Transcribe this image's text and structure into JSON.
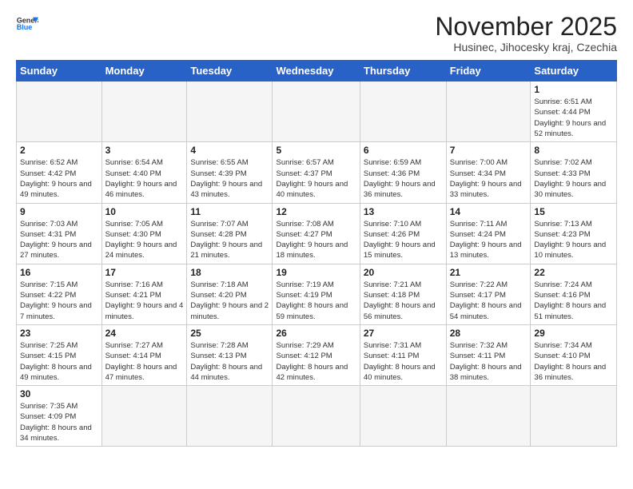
{
  "logo": {
    "line1": "General",
    "line2": "Blue"
  },
  "title": "November 2025",
  "subtitle": "Husinec, Jihocesky kraj, Czechia",
  "weekdays": [
    "Sunday",
    "Monday",
    "Tuesday",
    "Wednesday",
    "Thursday",
    "Friday",
    "Saturday"
  ],
  "weeks": [
    [
      {
        "day": "",
        "info": ""
      },
      {
        "day": "",
        "info": ""
      },
      {
        "day": "",
        "info": ""
      },
      {
        "day": "",
        "info": ""
      },
      {
        "day": "",
        "info": ""
      },
      {
        "day": "",
        "info": ""
      },
      {
        "day": "1",
        "info": "Sunrise: 6:51 AM\nSunset: 4:44 PM\nDaylight: 9 hours\nand 52 minutes."
      }
    ],
    [
      {
        "day": "2",
        "info": "Sunrise: 6:52 AM\nSunset: 4:42 PM\nDaylight: 9 hours\nand 49 minutes."
      },
      {
        "day": "3",
        "info": "Sunrise: 6:54 AM\nSunset: 4:40 PM\nDaylight: 9 hours\nand 46 minutes."
      },
      {
        "day": "4",
        "info": "Sunrise: 6:55 AM\nSunset: 4:39 PM\nDaylight: 9 hours\nand 43 minutes."
      },
      {
        "day": "5",
        "info": "Sunrise: 6:57 AM\nSunset: 4:37 PM\nDaylight: 9 hours\nand 40 minutes."
      },
      {
        "day": "6",
        "info": "Sunrise: 6:59 AM\nSunset: 4:36 PM\nDaylight: 9 hours\nand 36 minutes."
      },
      {
        "day": "7",
        "info": "Sunrise: 7:00 AM\nSunset: 4:34 PM\nDaylight: 9 hours\nand 33 minutes."
      },
      {
        "day": "8",
        "info": "Sunrise: 7:02 AM\nSunset: 4:33 PM\nDaylight: 9 hours\nand 30 minutes."
      }
    ],
    [
      {
        "day": "9",
        "info": "Sunrise: 7:03 AM\nSunset: 4:31 PM\nDaylight: 9 hours\nand 27 minutes."
      },
      {
        "day": "10",
        "info": "Sunrise: 7:05 AM\nSunset: 4:30 PM\nDaylight: 9 hours\nand 24 minutes."
      },
      {
        "day": "11",
        "info": "Sunrise: 7:07 AM\nSunset: 4:28 PM\nDaylight: 9 hours\nand 21 minutes."
      },
      {
        "day": "12",
        "info": "Sunrise: 7:08 AM\nSunset: 4:27 PM\nDaylight: 9 hours\nand 18 minutes."
      },
      {
        "day": "13",
        "info": "Sunrise: 7:10 AM\nSunset: 4:26 PM\nDaylight: 9 hours\nand 15 minutes."
      },
      {
        "day": "14",
        "info": "Sunrise: 7:11 AM\nSunset: 4:24 PM\nDaylight: 9 hours\nand 13 minutes."
      },
      {
        "day": "15",
        "info": "Sunrise: 7:13 AM\nSunset: 4:23 PM\nDaylight: 9 hours\nand 10 minutes."
      }
    ],
    [
      {
        "day": "16",
        "info": "Sunrise: 7:15 AM\nSunset: 4:22 PM\nDaylight: 9 hours\nand 7 minutes."
      },
      {
        "day": "17",
        "info": "Sunrise: 7:16 AM\nSunset: 4:21 PM\nDaylight: 9 hours\nand 4 minutes."
      },
      {
        "day": "18",
        "info": "Sunrise: 7:18 AM\nSunset: 4:20 PM\nDaylight: 9 hours\nand 2 minutes."
      },
      {
        "day": "19",
        "info": "Sunrise: 7:19 AM\nSunset: 4:19 PM\nDaylight: 8 hours\nand 59 minutes."
      },
      {
        "day": "20",
        "info": "Sunrise: 7:21 AM\nSunset: 4:18 PM\nDaylight: 8 hours\nand 56 minutes."
      },
      {
        "day": "21",
        "info": "Sunrise: 7:22 AM\nSunset: 4:17 PM\nDaylight: 8 hours\nand 54 minutes."
      },
      {
        "day": "22",
        "info": "Sunrise: 7:24 AM\nSunset: 4:16 PM\nDaylight: 8 hours\nand 51 minutes."
      }
    ],
    [
      {
        "day": "23",
        "info": "Sunrise: 7:25 AM\nSunset: 4:15 PM\nDaylight: 8 hours\nand 49 minutes."
      },
      {
        "day": "24",
        "info": "Sunrise: 7:27 AM\nSunset: 4:14 PM\nDaylight: 8 hours\nand 47 minutes."
      },
      {
        "day": "25",
        "info": "Sunrise: 7:28 AM\nSunset: 4:13 PM\nDaylight: 8 hours\nand 44 minutes."
      },
      {
        "day": "26",
        "info": "Sunrise: 7:29 AM\nSunset: 4:12 PM\nDaylight: 8 hours\nand 42 minutes."
      },
      {
        "day": "27",
        "info": "Sunrise: 7:31 AM\nSunset: 4:11 PM\nDaylight: 8 hours\nand 40 minutes."
      },
      {
        "day": "28",
        "info": "Sunrise: 7:32 AM\nSunset: 4:11 PM\nDaylight: 8 hours\nand 38 minutes."
      },
      {
        "day": "29",
        "info": "Sunrise: 7:34 AM\nSunset: 4:10 PM\nDaylight: 8 hours\nand 36 minutes."
      }
    ],
    [
      {
        "day": "30",
        "info": "Sunrise: 7:35 AM\nSunset: 4:09 PM\nDaylight: 8 hours\nand 34 minutes."
      },
      {
        "day": "",
        "info": ""
      },
      {
        "day": "",
        "info": ""
      },
      {
        "day": "",
        "info": ""
      },
      {
        "day": "",
        "info": ""
      },
      {
        "day": "",
        "info": ""
      },
      {
        "day": "",
        "info": ""
      }
    ]
  ]
}
